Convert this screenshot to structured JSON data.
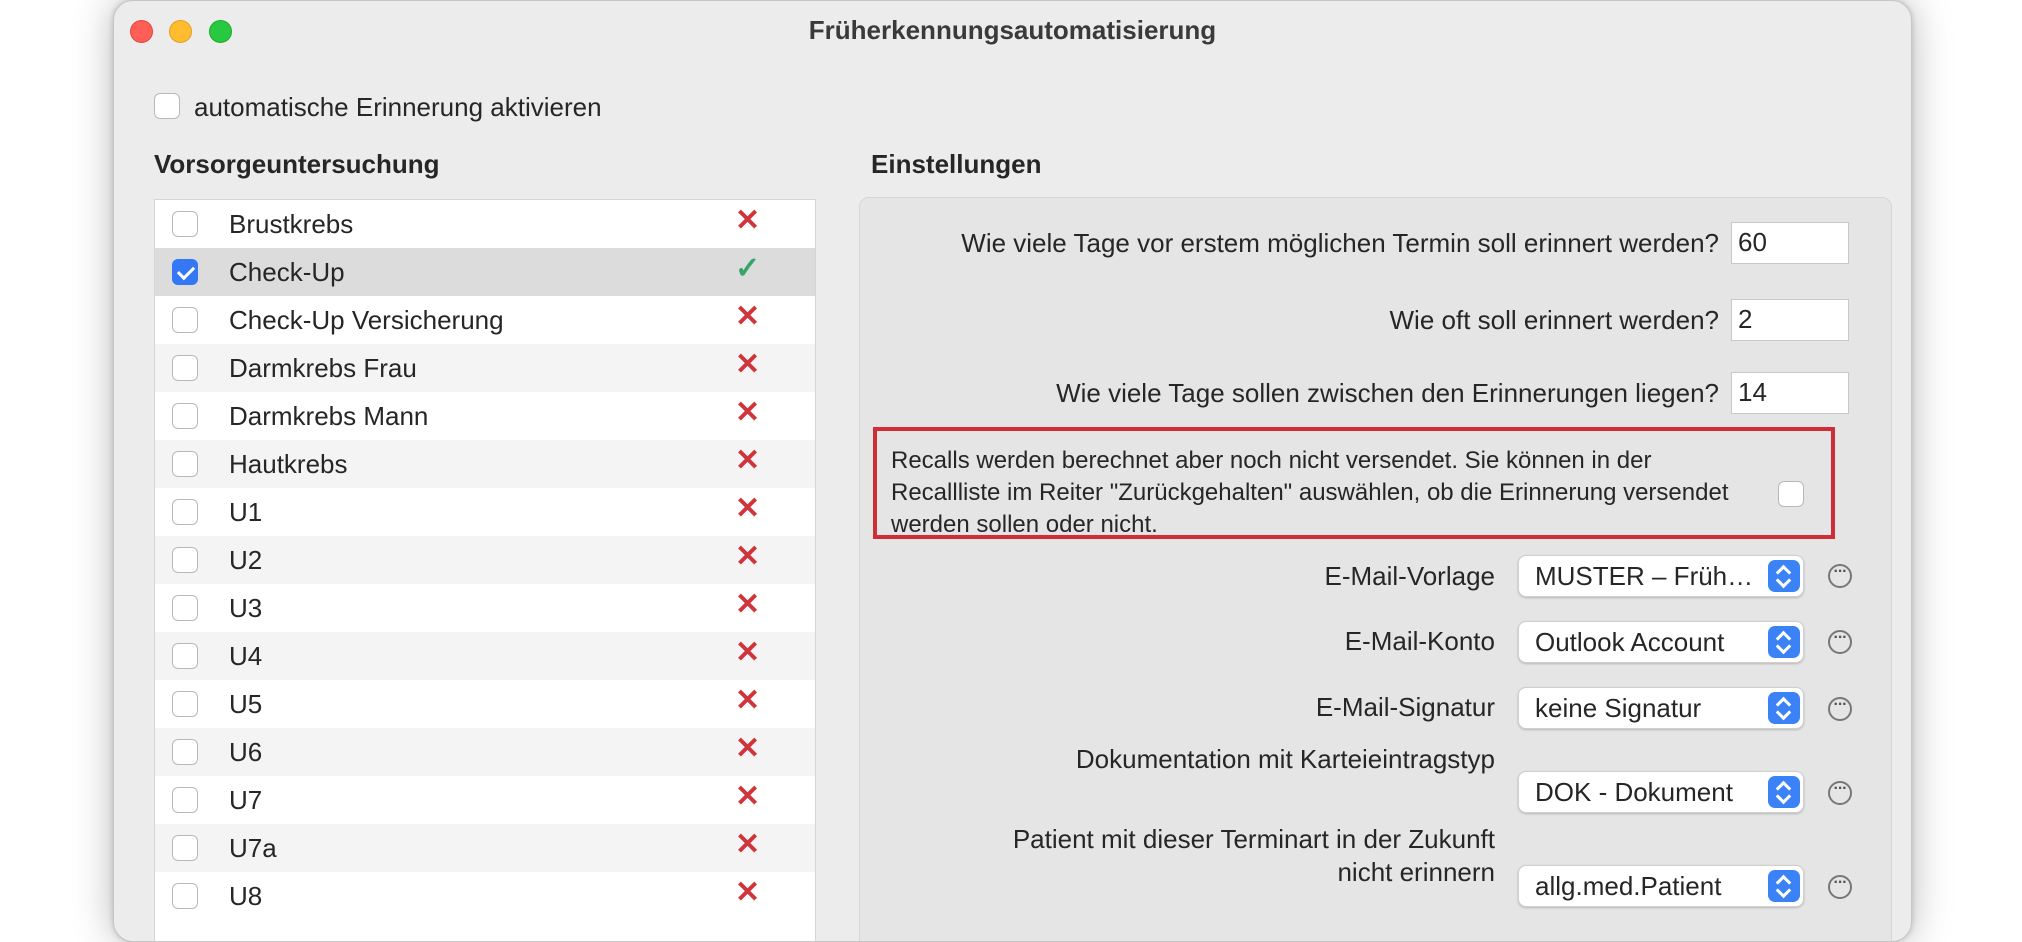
{
  "window": {
    "title": "Früherkennungsautomatisierung"
  },
  "auto_reminder": {
    "label": "automatische Erinnerung aktivieren",
    "checked": false
  },
  "left_section": {
    "title": "Vorsorgeuntersuchung",
    "items": [
      {
        "label": "Brustkrebs",
        "checked": false,
        "status": "✕"
      },
      {
        "label": "Check-Up",
        "checked": true,
        "status": "✓"
      },
      {
        "label": "Check-Up Versicherung",
        "checked": false,
        "status": "✕"
      },
      {
        "label": "Darmkrebs Frau",
        "checked": false,
        "status": "✕"
      },
      {
        "label": "Darmkrebs Mann",
        "checked": false,
        "status": "✕"
      },
      {
        "label": "Hautkrebs",
        "checked": false,
        "status": "✕"
      },
      {
        "label": "U1",
        "checked": false,
        "status": "✕"
      },
      {
        "label": "U2",
        "checked": false,
        "status": "✕"
      },
      {
        "label": "U3",
        "checked": false,
        "status": "✕"
      },
      {
        "label": "U4",
        "checked": false,
        "status": "✕"
      },
      {
        "label": "U5",
        "checked": false,
        "status": "✕"
      },
      {
        "label": "U6",
        "checked": false,
        "status": "✕"
      },
      {
        "label": "U7",
        "checked": false,
        "status": "✕"
      },
      {
        "label": "U7a",
        "checked": false,
        "status": "✕"
      },
      {
        "label": "U8",
        "checked": false,
        "status": "✕"
      }
    ]
  },
  "settings": {
    "title": "Einstellungen",
    "days_before_label": "Wie viele Tage vor erstem möglichen Termin soll erinnert werden?",
    "days_before_value": "60",
    "how_often_label": "Wie oft soll erinnert werden?",
    "how_often_value": "2",
    "days_between_label": "Wie viele Tage sollen zwischen den Erinnerungen liegen?",
    "days_between_value": "14",
    "hold_back_text": "Recalls werden berechnet aber noch nicht versendet. Sie können in der Recallliste im Reiter \"Zurückgehalten\" auswählen, ob die Erinnerung versendet werden sollen oder nicht.",
    "email_template_label": "E-Mail-Vorlage",
    "email_template_value": "MUSTER – Früherkennung",
    "email_account_label": "E-Mail-Konto",
    "email_account_value": "Outlook Account",
    "email_signature_label": "E-Mail-Signatur",
    "email_signature_value": "keine Signatur",
    "documentation_label": "Dokumentation mit Karteieintragstyp",
    "documentation_value": "DOK - Dokument",
    "appointment_label_line1": "Patient mit dieser Terminart in der Zukunft",
    "appointment_label_line2": "nicht erinnern",
    "appointment_value": "allg.med.Patient",
    "more_glyph": "···"
  },
  "colors": {
    "accent": "#3478f6",
    "error": "#d0333b",
    "success": "#37a56a",
    "highlight_border": "#d12d36"
  }
}
